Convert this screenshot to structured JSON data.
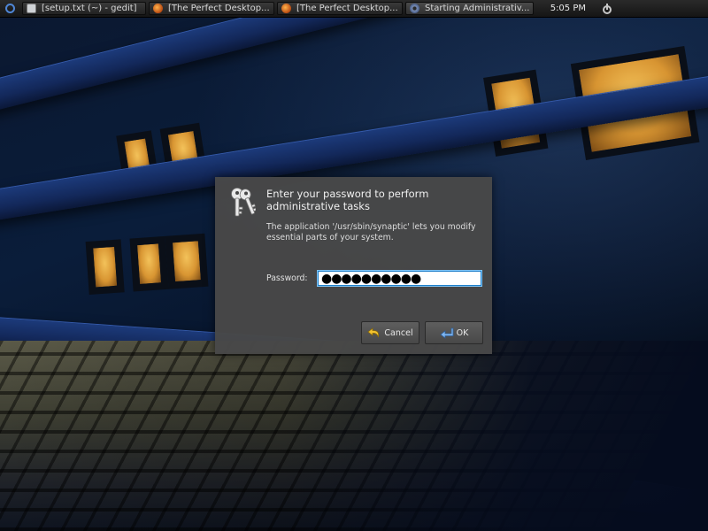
{
  "panel": {
    "tasks": [
      {
        "label": "[setup.txt (~) - gedit]",
        "icon": "text-document-icon"
      },
      {
        "label": "[The Perfect Desktop...",
        "icon": "firefox-icon"
      },
      {
        "label": "[The Perfect Desktop...",
        "icon": "firefox-icon"
      },
      {
        "label": "Starting Administrativ...",
        "icon": "gear-icon"
      }
    ],
    "clock": "5:05 PM"
  },
  "dialog": {
    "title": "Enter your password to perform administrative tasks",
    "message": "The application '/usr/sbin/synaptic' lets you modify essential parts of your system.",
    "password_label": "Password:",
    "password_value": "●●●●●●●●●●",
    "cancel_label": "Cancel",
    "ok_label": "OK",
    "icon": "keys-icon"
  },
  "colors": {
    "dialog_bg": "#484848",
    "input_focus": "#1f7fc9",
    "panel_bg": "#1e1e1e"
  }
}
